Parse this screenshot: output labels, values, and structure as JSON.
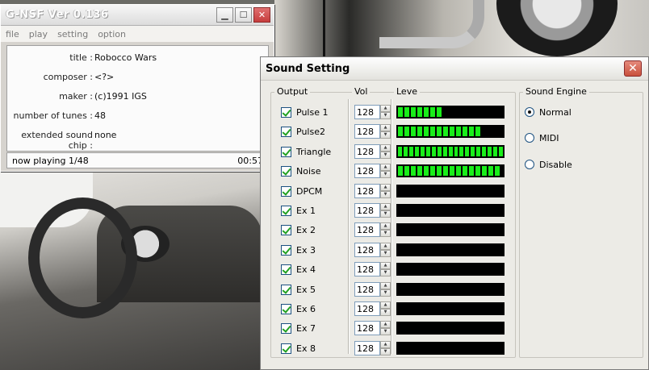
{
  "gnsf": {
    "title": "G-NSF Ver 0.136",
    "menu": [
      "file",
      "play",
      "setting",
      "option"
    ],
    "info": {
      "title_label": "title :",
      "title_value": "Robocco Wars",
      "composer_label": "composer :",
      "composer_value": "<?>",
      "maker_label": "maker :",
      "maker_value": "(c)1991 IGS",
      "tunes_label": "number of tunes :",
      "tunes_value": "48",
      "chip_label": "extended sound chip :",
      "chip_value": "none"
    },
    "status": "now playing 1/48",
    "time": "00:57"
  },
  "sound": {
    "title": "Sound Setting",
    "output_label": "Output",
    "vol_label": "Vol",
    "level_label": "Leve",
    "engine_label": "Sound Engine",
    "level_max_segments": 19,
    "channels": [
      {
        "name": "Pulse 1",
        "checked": true,
        "vol": "128",
        "level": 7
      },
      {
        "name": "Pulse2",
        "checked": true,
        "vol": "128",
        "level": 13
      },
      {
        "name": "Triangle",
        "checked": true,
        "vol": "128",
        "level": 19
      },
      {
        "name": "Noise",
        "checked": true,
        "vol": "128",
        "level": 16
      },
      {
        "name": "DPCM",
        "checked": true,
        "vol": "128",
        "level": 0
      },
      {
        "name": "Ex 1",
        "checked": true,
        "vol": "128",
        "level": 0
      },
      {
        "name": "Ex 2",
        "checked": true,
        "vol": "128",
        "level": 0
      },
      {
        "name": "Ex 3",
        "checked": true,
        "vol": "128",
        "level": 0
      },
      {
        "name": "Ex 4",
        "checked": true,
        "vol": "128",
        "level": 0
      },
      {
        "name": "Ex 5",
        "checked": true,
        "vol": "128",
        "level": 0
      },
      {
        "name": "Ex 6",
        "checked": true,
        "vol": "128",
        "level": 0
      },
      {
        "name": "Ex 7",
        "checked": true,
        "vol": "128",
        "level": 0
      },
      {
        "name": "Ex 8",
        "checked": true,
        "vol": "128",
        "level": 0
      }
    ],
    "engines": [
      {
        "name": "Normal",
        "selected": true
      },
      {
        "name": "MIDI",
        "selected": false
      },
      {
        "name": "Disable",
        "selected": false
      }
    ]
  },
  "colors": {
    "meter_on": "#19ee19",
    "meter_bg": "#000000"
  }
}
